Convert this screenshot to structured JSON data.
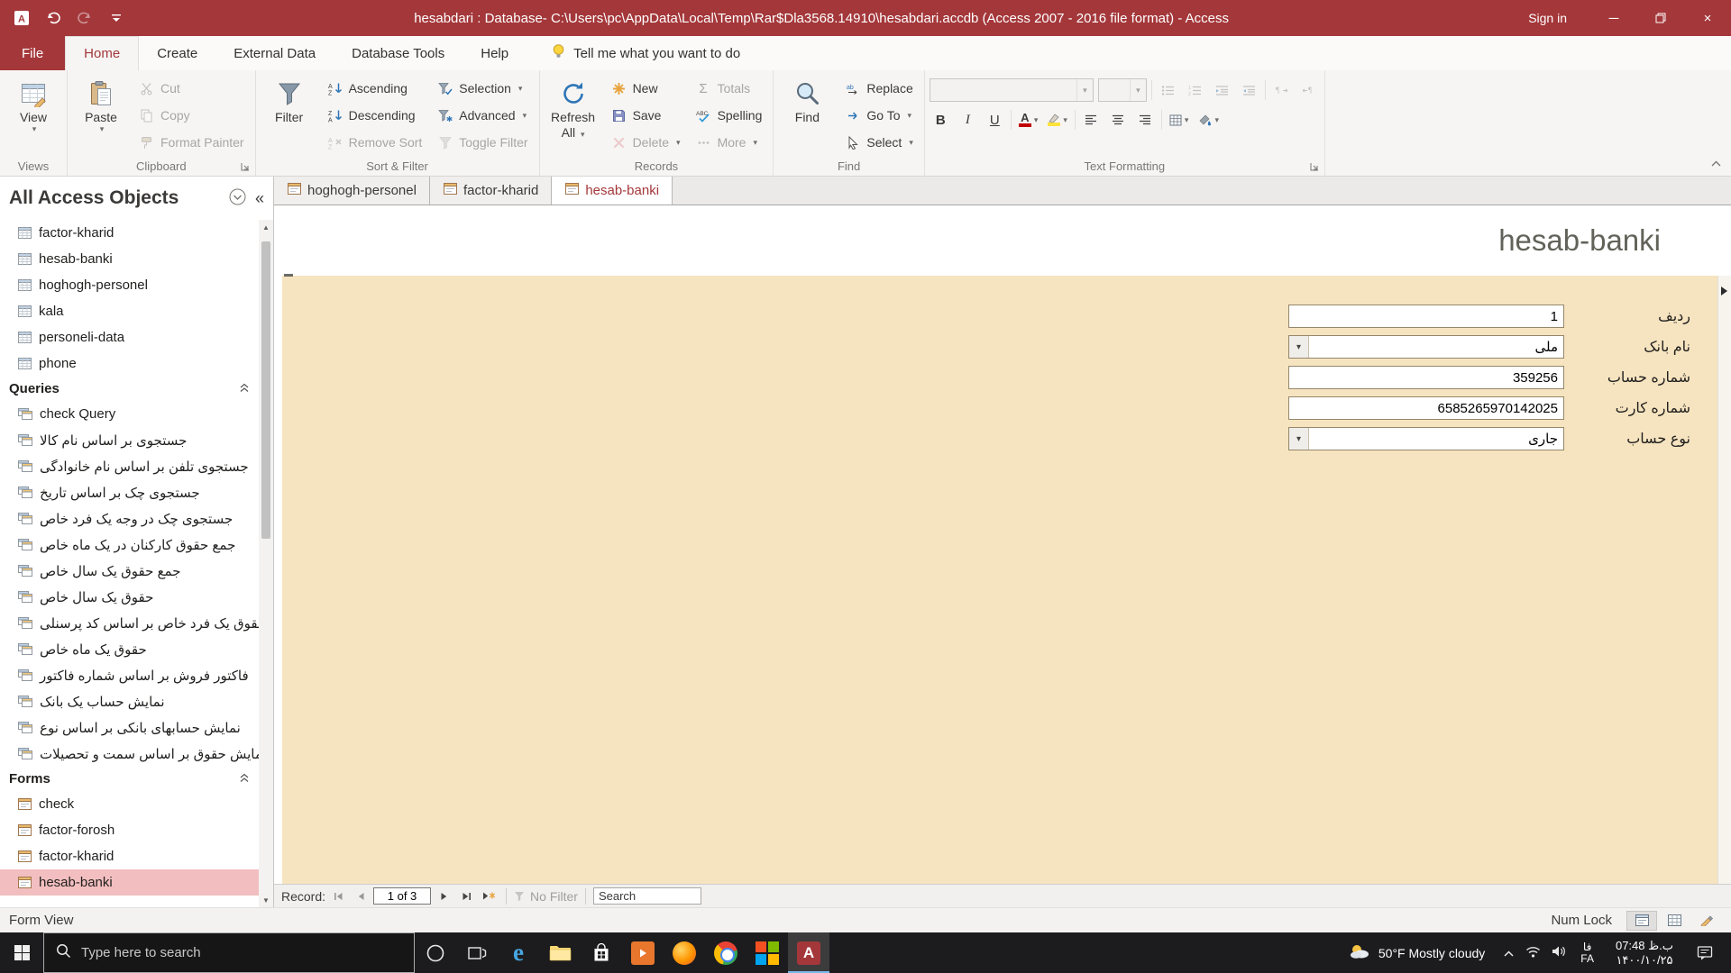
{
  "glyphs": {
    "caret": "▾",
    "win_min": "─",
    "win_close": "×",
    "collapse_pane": "«",
    "sigma": "Σ",
    "close_tab": "×",
    "edge_e": "e",
    "access_a": "A"
  },
  "titlebar": {
    "app_title": "hesabdari : Database- C:\\Users\\pc\\AppData\\Local\\Temp\\Rar$Dla3568.14910\\hesabdari.accdb (Access 2007 - 2016 file format)  -  Access",
    "sign_in": "Sign in"
  },
  "menu": {
    "file": "File",
    "home": "Home",
    "create": "Create",
    "external_data": "External Data",
    "database_tools": "Database Tools",
    "help": "Help",
    "tell_me": "Tell me what you want to do"
  },
  "ribbon": {
    "views": {
      "label": "Views",
      "view": "View"
    },
    "clipboard": {
      "label": "Clipboard",
      "paste": "Paste",
      "cut": "Cut",
      "copy": "Copy",
      "format_painter": "Format Painter"
    },
    "sort_filter": {
      "label": "Sort & Filter",
      "filter": "Filter",
      "ascending": "Ascending",
      "descending": "Descending",
      "remove_sort": "Remove Sort",
      "selection": "Selection",
      "advanced": "Advanced",
      "toggle_filter": "Toggle Filter"
    },
    "records": {
      "label": "Records",
      "refresh_line1": "Refresh",
      "refresh_line2": "All",
      "new": "New",
      "save": "Save",
      "delete": "Delete",
      "totals": "Totals",
      "spelling": "Spelling",
      "more": "More"
    },
    "find": {
      "label": "Find",
      "find": "Find",
      "replace": "Replace",
      "go_to": "Go To",
      "select": "Select"
    },
    "text_formatting": {
      "label": "Text Formatting",
      "bold": "B",
      "italic": "I",
      "underline": "U",
      "font_color": "A"
    }
  },
  "nav_pane": {
    "title": "All Access Objects",
    "tables": [
      "factor-kharid",
      "hesab-banki",
      "hoghogh-personel",
      "kala",
      "personeli-data",
      "phone"
    ],
    "queries_header": "Queries",
    "queries": [
      "check Query",
      "جستجوی بر اساس نام کالا",
      "جستجوی تلفن بر اساس نام خانوادگی",
      "جستجوی چک بر اساس تاریخ",
      "جستجوی چک در وجه یک فرد خاص",
      "جمع حقوق کارکنان در یک ماه خاص",
      "جمع حقوق یک سال خاص",
      "حقوق یک سال خاص",
      "حقوق یک فرد خاص بر اساس کد پرسنلی",
      "حقوق یک ماه خاص",
      "فاکتور فروش بر اساس شماره فاکتور",
      "نمایش حساب یک بانک",
      "نمایش حسابهای بانکی بر اساس نوع",
      "نمایش حقوق بر اساس سمت و تحصیلات"
    ],
    "forms_header": "Forms",
    "forms": [
      {
        "label": "check"
      },
      {
        "label": "factor-forosh"
      },
      {
        "label": "factor-kharid"
      },
      {
        "label": "hesab-banki",
        "selected": true
      }
    ]
  },
  "doc_tabs": [
    {
      "label": "hoghogh-personel"
    },
    {
      "label": "factor-kharid"
    },
    {
      "label": "hesab-banki",
      "active": true
    }
  ],
  "form": {
    "title": "hesab-banki",
    "fields": [
      {
        "label": "ردیف",
        "value": "1",
        "type": "text"
      },
      {
        "label": "نام بانک",
        "value": "ملی",
        "type": "combo"
      },
      {
        "label": "شماره حساب",
        "value": "359256",
        "type": "text"
      },
      {
        "label": "شماره کارت",
        "value": "6585265970142025",
        "type": "text"
      },
      {
        "label": "نوع حساب",
        "value": "جاری",
        "type": "combo"
      }
    ]
  },
  "record_nav": {
    "label": "Record:",
    "position": "1 of 3",
    "no_filter": "No Filter",
    "search_placeholder": "Search"
  },
  "status_bar": {
    "view": "Form View",
    "num_lock": "Num Lock"
  },
  "taskbar": {
    "search_placeholder": "Type here to search",
    "weather": "50°F  Mostly cloudy",
    "lang_top": "فا",
    "lang_bottom": "FA",
    "time": "07:48 ب.ظ",
    "date": "۱۴۰۰/۱۰/۲۵"
  }
}
